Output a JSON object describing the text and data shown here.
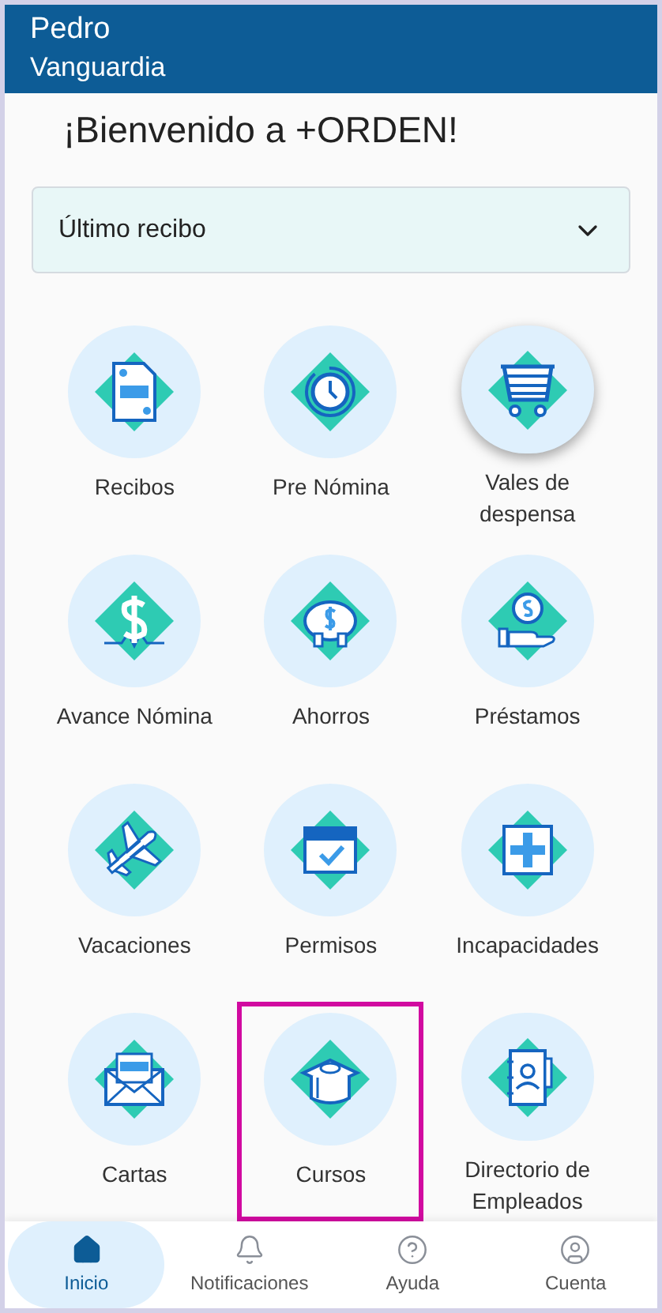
{
  "header": {
    "first_name": "Pedro",
    "last_name": "Vanguardia"
  },
  "welcome": "¡Bienvenido a +ORDEN!",
  "accordion": {
    "title": "Último recibo",
    "expanded": false
  },
  "modules": [
    {
      "kind": "receipt",
      "label": "Recibos",
      "raised": false,
      "highlighted": false
    },
    {
      "kind": "clock",
      "label": "Pre Nómina",
      "raised": false,
      "highlighted": false
    },
    {
      "kind": "cart",
      "label": "Vales de despensa",
      "raised": true,
      "highlighted": false
    },
    {
      "kind": "dollar",
      "label": "Avance Nómina",
      "raised": false,
      "highlighted": false
    },
    {
      "kind": "piggy",
      "label": "Ahorros",
      "raised": false,
      "highlighted": false
    },
    {
      "kind": "hand",
      "label": "Préstamos",
      "raised": false,
      "highlighted": false
    },
    {
      "kind": "plane",
      "label": "Vacaciones",
      "raised": false,
      "highlighted": false
    },
    {
      "kind": "calendar",
      "label": "Permisos",
      "raised": false,
      "highlighted": false
    },
    {
      "kind": "medical",
      "label": "Incapacidades",
      "raised": false,
      "highlighted": false
    },
    {
      "kind": "letter",
      "label": "Cartas",
      "raised": false,
      "highlighted": false
    },
    {
      "kind": "cap",
      "label": "Cursos",
      "raised": false,
      "highlighted": true
    },
    {
      "kind": "directory",
      "label": "Directorio de Empleados",
      "raised": false,
      "highlighted": false
    }
  ],
  "nav": [
    {
      "kind": "home",
      "label": "Inicio",
      "selected": true
    },
    {
      "kind": "bell",
      "label": "Notificaciones",
      "selected": false
    },
    {
      "kind": "help",
      "label": "Ayuda",
      "selected": false
    },
    {
      "kind": "account",
      "label": "Cuenta",
      "selected": false
    }
  ]
}
